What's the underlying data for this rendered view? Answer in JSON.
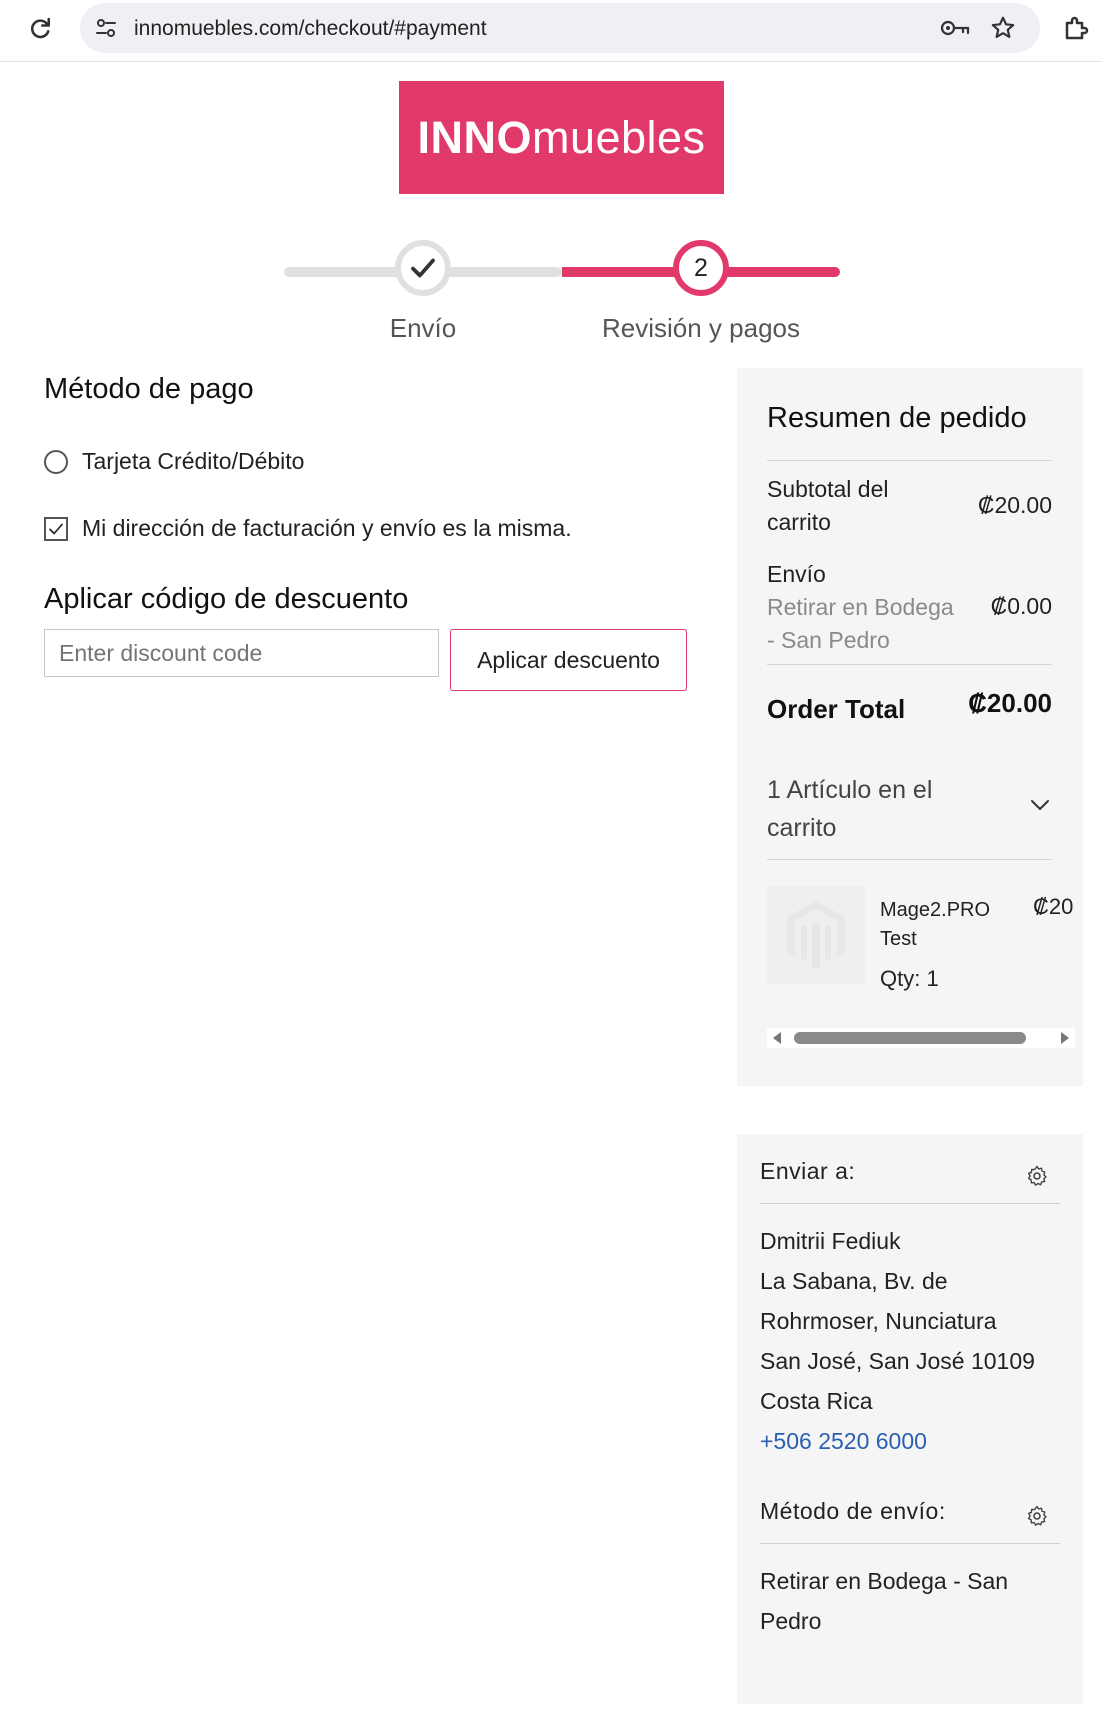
{
  "browser": {
    "url": "innomuebles.com/checkout/#payment"
  },
  "logo": {
    "bold": "INNO",
    "rest": "muebles"
  },
  "steps": [
    {
      "label": "Envío",
      "state": "done"
    },
    {
      "number": "2",
      "label": "Revisión y pagos",
      "state": "active"
    }
  ],
  "payment": {
    "title": "Método de pago",
    "option_label": "Tarjeta Crédito/Débito",
    "billing_same_label": "Mi dirección de facturación y envío es la misma.",
    "billing_same_checked": true
  },
  "discount": {
    "title": "Aplicar código de descuento",
    "placeholder": "Enter discount code",
    "button_label": "Aplicar descuento"
  },
  "summary": {
    "title": "Resumen de pedido",
    "subtotal_label_1": "Subtotal del",
    "subtotal_label_2": "carrito",
    "subtotal_value": "₡20.00",
    "shipping_label": "Envío",
    "shipping_method_1": "Retirar en Bodega",
    "shipping_method_2": "- San Pedro",
    "shipping_value": "₡0.00",
    "order_total_label": "Order Total",
    "order_total_value": "₡20.00",
    "items_label": "1 Artículo en el carrito",
    "item": {
      "name_1": "Mage2.PRO",
      "name_2": "Test",
      "price": "₡20",
      "qty": "Qty: 1"
    }
  },
  "ship_to": {
    "title": "Enviar a:",
    "name": "Dmitrii Fediuk",
    "line1": "La Sabana, Bv. de",
    "line2": "Rohrmoser, Nunciatura",
    "line3": "San José, San José 10109",
    "country": "Costa Rica",
    "phone": "+506 2520 6000"
  },
  "ship_method": {
    "title": "Método de envío:",
    "line1": "Retirar en Bodega - San",
    "line2": "Pedro"
  },
  "colors": {
    "brand": "#e13a6a",
    "panel_bg": "#f5f5f5",
    "link": "#2b5fb3"
  }
}
